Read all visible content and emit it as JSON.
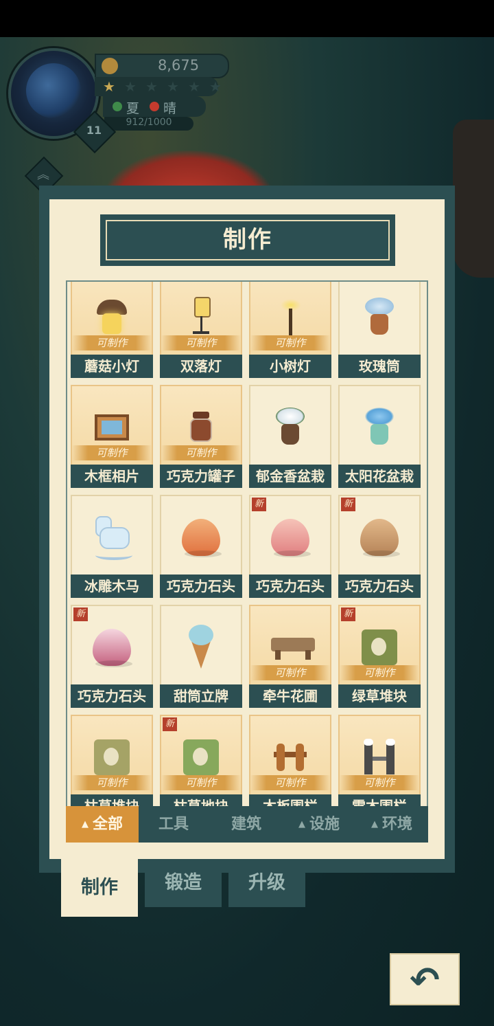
{
  "hud": {
    "coins": "8,675",
    "stars_filled": 1,
    "stars_total": 6,
    "season": "夏",
    "weather": "晴",
    "xp": "912/1000",
    "level": "11",
    "season_color": "#3f8a4a",
    "weather_color": "#c43b2e"
  },
  "panel": {
    "title": "制作",
    "craft_label": "可制作",
    "new_label": "新"
  },
  "items": [
    {
      "name": "蘑菇小灯",
      "craftable": true,
      "new": false,
      "art": "mushroom"
    },
    {
      "name": "双落灯",
      "craftable": true,
      "new": false,
      "art": "lamp"
    },
    {
      "name": "小树灯",
      "craftable": true,
      "new": false,
      "art": "tree"
    },
    {
      "name": "玫瑰筒",
      "craftable": false,
      "new": false,
      "art": "pot-rose"
    },
    {
      "name": "木框相片",
      "craftable": true,
      "new": false,
      "art": "frame"
    },
    {
      "name": "巧克力罐子",
      "craftable": true,
      "new": false,
      "art": "jar"
    },
    {
      "name": "郁金香盆栽",
      "craftable": false,
      "new": false,
      "art": "pot-tulip"
    },
    {
      "name": "太阳花盆栽",
      "craftable": false,
      "new": false,
      "art": "pot-sun"
    },
    {
      "name": "冰雕木马",
      "craftable": false,
      "new": false,
      "art": "horse"
    },
    {
      "name": "巧克力石头",
      "craftable": false,
      "new": false,
      "art": "rock-orange"
    },
    {
      "name": "巧克力石头",
      "craftable": false,
      "new": true,
      "art": "rock-pink"
    },
    {
      "name": "巧克力石头",
      "craftable": false,
      "new": true,
      "art": "rock-brown"
    },
    {
      "name": "巧克力石头",
      "craftable": false,
      "new": true,
      "art": "rock-rose"
    },
    {
      "name": "甜筒立牌",
      "craftable": false,
      "new": false,
      "art": "cone"
    },
    {
      "name": "牵牛花圃",
      "craftable": true,
      "new": false,
      "art": "bench"
    },
    {
      "name": "绿草堆块",
      "craftable": true,
      "new": true,
      "art": "grass-green"
    },
    {
      "name": "枯草堆块",
      "craftable": true,
      "new": false,
      "art": "grass-dry"
    },
    {
      "name": "枯草地块",
      "craftable": true,
      "new": true,
      "art": "grass-patch"
    },
    {
      "name": "木板围栏",
      "craftable": true,
      "new": false,
      "art": "fence"
    },
    {
      "name": "雪木围栏",
      "craftable": true,
      "new": false,
      "art": "snowfence"
    }
  ],
  "filters": [
    {
      "label": "全部",
      "arrow": true,
      "active": true
    },
    {
      "label": "工具",
      "arrow": false,
      "active": false
    },
    {
      "label": "建筑",
      "arrow": false,
      "active": false
    },
    {
      "label": "设施",
      "arrow": true,
      "active": false
    },
    {
      "label": "环境",
      "arrow": true,
      "active": false
    }
  ],
  "bottom_tabs": [
    {
      "label": "制作",
      "active": true
    },
    {
      "label": "锻造",
      "active": false
    },
    {
      "label": "升级",
      "active": false
    }
  ],
  "back_icon": "undo-arrow-icon"
}
